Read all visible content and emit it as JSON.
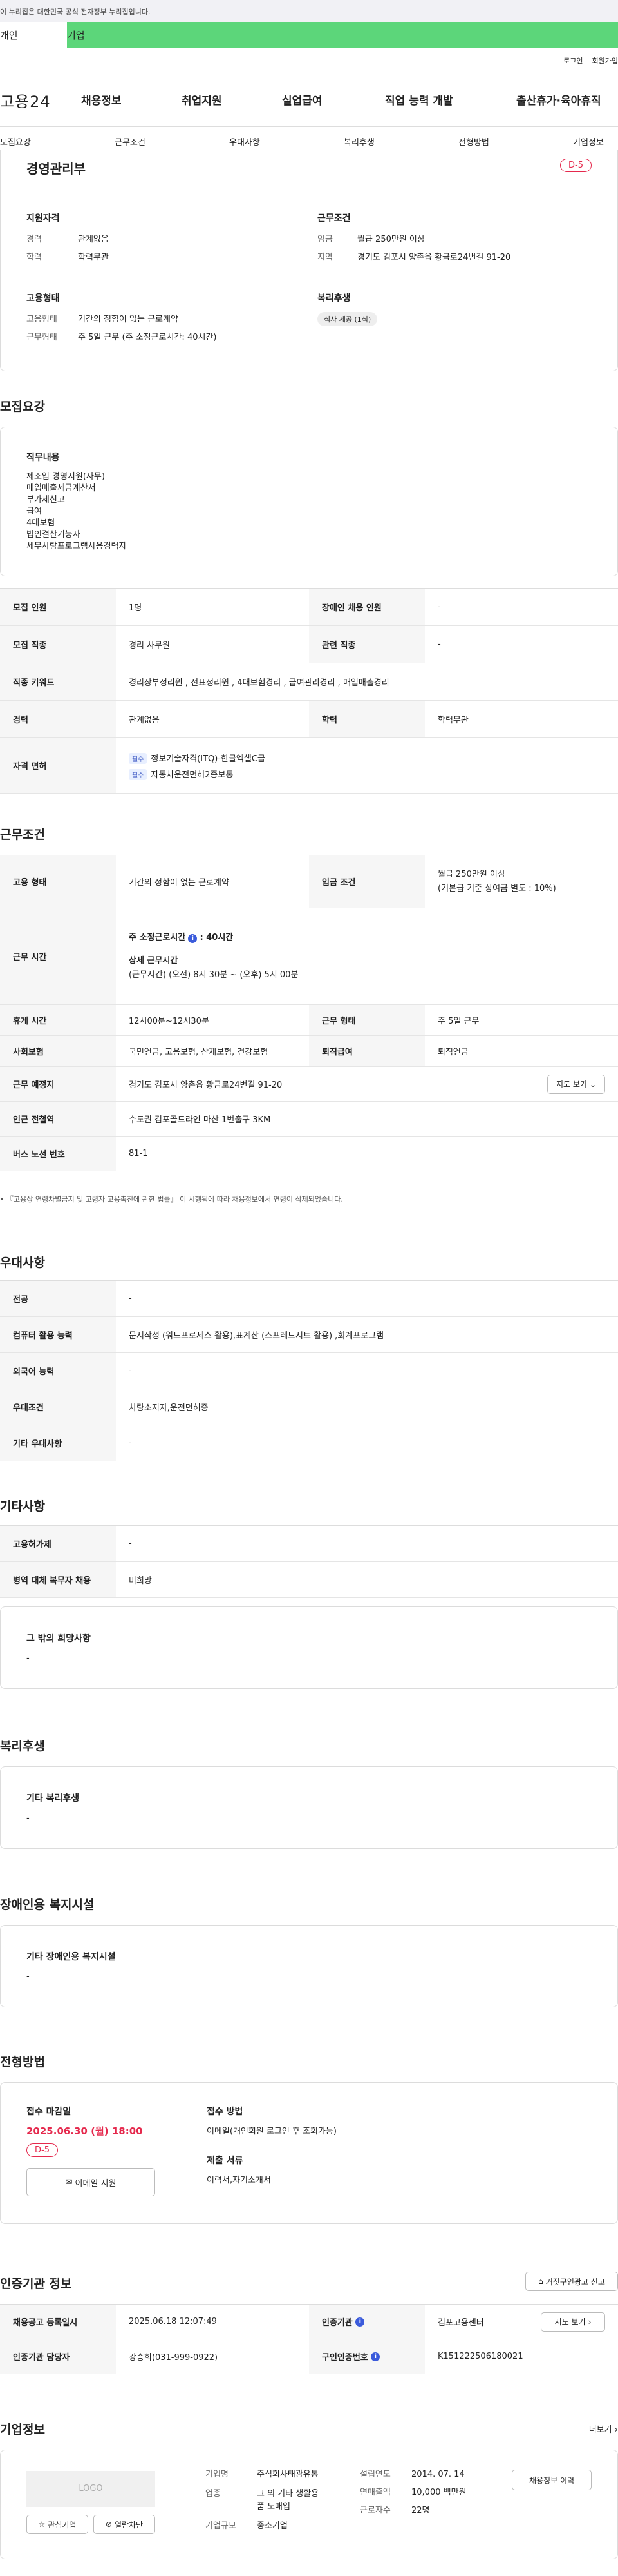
{
  "gov_banner": "이 누리집은 대한민국 공식 전자정부 누리집입니다.",
  "topbar": {
    "tab_personal": "개인",
    "tab_company": "기업"
  },
  "util": {
    "login": "로그인",
    "signup": "회원가입"
  },
  "logo": "고용24",
  "gnb": [
    "채용정보",
    "취업지원",
    "실업급여",
    "직업 능력 개발",
    "출산휴가·육아휴직"
  ],
  "subnav": [
    "모집요강",
    "근무조건",
    "우대사항",
    "복리후생",
    "전형방법",
    "기업정보"
  ],
  "summary": {
    "title": "경영관리부",
    "dday": "D-5",
    "qual": {
      "heading": "지원자격",
      "career_k": "경력",
      "career_v": "관계없음",
      "edu_k": "학력",
      "edu_v": "학력무관"
    },
    "cond": {
      "heading": "근무조건",
      "wage_k": "임금",
      "wage_v": "월급 250만원 이상",
      "area_k": "지역",
      "area_v": "경기도 김포시 양촌읍 황금로24번길 91-20"
    },
    "emp": {
      "heading": "고용형태",
      "type_k": "고용형태",
      "type_v": "기간의 정함이 없는 근로계약",
      "work_k": "근무형태",
      "work_v": "주 5일 근무 (주 소정근로시간: 40시간)"
    },
    "welfare": {
      "heading": "복리후생",
      "tag": "식사 제공 (1식)"
    }
  },
  "recruit": {
    "title": "모집요강",
    "job_heading": "직무내용",
    "job_lines": [
      "제조업 경영지원(사무)",
      "매입매출세금계산서",
      "부가세신고",
      "급여",
      "4대보험",
      "법인결산기능자",
      "세무사랑프로그램사용경력자"
    ],
    "rows": {
      "count_k": "모집 인원",
      "count_v": "1명",
      "dis_k": "장애인 채용 인원",
      "dis_v": "-",
      "job_k": "모집 직종",
      "job_v": "경리 사무원",
      "rel_k": "관련 직종",
      "rel_v": "-",
      "kw_k": "직종 키워드",
      "kw_v": "경리장부정리원 , 전표정리원 , 4대보험경리 , 급여관리경리 , 매입매출경리",
      "career_k": "경력",
      "career_v": "관계없음",
      "edu_k": "학력",
      "edu_v": "학력무관",
      "cert_k": "자격 면허",
      "cert_tag": "필수",
      "cert1": "정보기술자격(ITQ)-한글엑셀C급",
      "cert2": "자동차운전면허2종보통"
    }
  },
  "work": {
    "title": "근무조건",
    "emp_k": "고용 형태",
    "emp_v": "기간의 정함이 없는 근로계약",
    "wage_k": "임금 조건",
    "wage_v1": "월급 250만원 이상",
    "wage_v2": "(기본급 기준 상여금 별도 : 10%)",
    "time_k": "근무 시간",
    "time_line1": "주 소정근로시간",
    "time_line1_val": ": 40시간",
    "time_detail_h": "상세 근무시간",
    "time_detail": "(근무시간) (오전) 8시 30분 ~ (오후) 5시 00분",
    "rest_k": "휴게 시간",
    "rest_v": "12시00분~12시30분",
    "shape_k": "근무 형태",
    "shape_v": "주 5일 근무",
    "ins_k": "사회보험",
    "ins_v": "국민연금, 고용보험, 산재보험, 건강보험",
    "pension_k": "퇴직급여",
    "pension_v": "퇴직연금",
    "place_k": "근무 예정지",
    "place_v": "경기도 김포시 양촌읍 황금로24번길 91-20",
    "map_btn": "지도 보기",
    "subway_k": "인근 전철역",
    "subway_v": "수도권 김포골드라인 마산 1번출구 3KM",
    "bus_k": "버스 노선 번호",
    "bus_v": "81-1",
    "note": "『고용상 연령차별금지 및 고령자 고용촉진에 관한 법률』 이 시행됨에 따라 채용정보에서 연령이 삭제되었습니다."
  },
  "pref": {
    "title": "우대사항",
    "major_k": "전공",
    "major_v": "-",
    "pc_k": "컴퓨터 활용 능력",
    "pc_v": "문서작성 (워드프로세스 활용),표계산 (스프레드시트 활용) ,회계프로그램",
    "lang_k": "외국어 능력",
    "lang_v": "-",
    "cond_k": "우대조건",
    "cond_v": "차량소지자,운전면허증",
    "etc_k": "기타 우대사항",
    "etc_v": "-"
  },
  "etc": {
    "title": "기타사항",
    "idle_k": "고용허가제",
    "idle_v": "-",
    "mil_k": "병역 대체 복무자 채용",
    "mil_v": "비희망",
    "hope_h": "그 밖의 희망사항",
    "hope_v": "-"
  },
  "welfare": {
    "title": "복리후생",
    "h": "기타 복리후생",
    "v": "-"
  },
  "disab": {
    "title": "장애인용 복지시설",
    "h": "기타 장애인용 복지시설",
    "v": "-"
  },
  "process": {
    "title": "전형방법",
    "deadline_h": "접수 마감일",
    "deadline_v": "2025.06.30 (월) 18:00",
    "dday": "D-5",
    "apply_btn": "이메일 지원",
    "method_h": "접수 방법",
    "method_v": "이메일(개인회원 로그인 후 조회가능)",
    "docs_h": "제출 서류",
    "docs_v": "이력서,자기소개서"
  },
  "agency": {
    "title": "인증기관 정보",
    "report_btn": "거짓구인광고 신고",
    "date_k": "채용공고 등록일시",
    "date_v": "2025.06.18 12:07:49",
    "org_k": "인증기관",
    "org_v": "김포고용센터",
    "map_btn": "지도 보기",
    "mgr_k": "인증기관 담당자",
    "mgr_v": "강승희(031-999-0922)",
    "no_k": "구인인증번호",
    "no_v": "K151222506180021"
  },
  "company": {
    "title": "기업정보",
    "more": "더보기",
    "logo": "LOGO",
    "fav_btn": "관심기업",
    "block_btn": "열람차단",
    "name_k": "기업명",
    "name_v": "주식회사태광유통",
    "ind_k": "업종",
    "ind_v1": "그 외 기타 생활용",
    "ind_v2": "품 도매업",
    "size_k": "기업규모",
    "size_v": "중소기업",
    "year_k": "설립연도",
    "year_v": "2014. 07. 14",
    "sales_k": "연매출액",
    "sales_v": "10,000 백만원",
    "emp_k": "근로자수",
    "emp_v": "22명",
    "jobs_btn": "채용정보 이력"
  },
  "colors": {
    "accent": "#5cd67a",
    "red": "#e5294d",
    "blue": "#3b5bdb"
  }
}
